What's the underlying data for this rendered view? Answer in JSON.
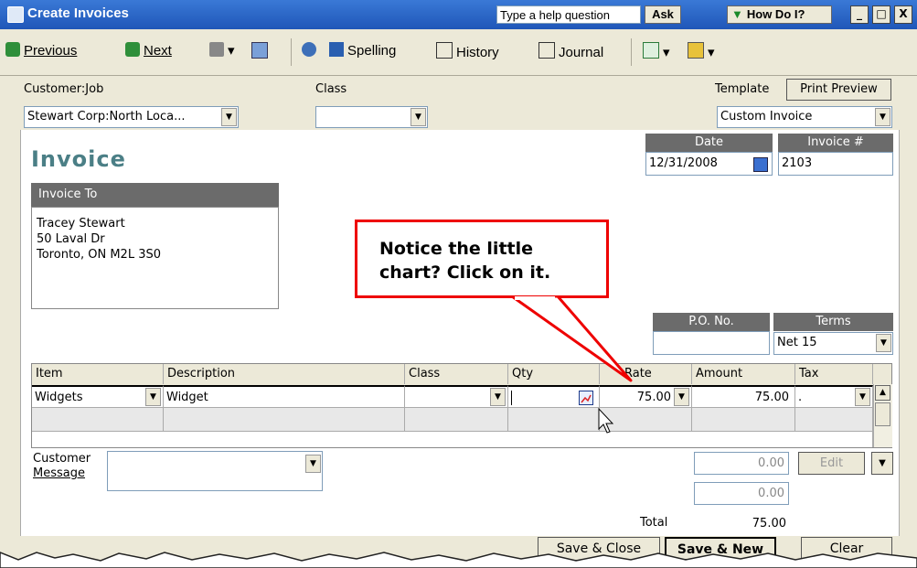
{
  "window": {
    "title": "Create Invoices",
    "help_placeholder": "Type a help question",
    "ask_label": "Ask",
    "howdo_label": "How Do I?"
  },
  "toolbar": {
    "previous": "Previous",
    "next": "Next",
    "spelling": "Spelling",
    "history": "History",
    "journal": "Journal"
  },
  "form": {
    "customer_job_label": "Customer:Job",
    "customer_job_value": "Stewart Corp:North Loca...",
    "class_label": "Class",
    "class_value": "",
    "template_label": "Template",
    "print_preview_label": "Print Preview",
    "template_value": "Custom Invoice",
    "invoice_heading": "Invoice",
    "date_label": "Date",
    "date_value": "12/31/2008",
    "invoice_no_label": "Invoice #",
    "invoice_no_value": "2103",
    "invoice_to_label": "Invoice To",
    "bill_to": [
      "Tracey Stewart",
      "50 Laval Dr",
      "Toronto, ON M2L 3S0"
    ],
    "po_label": "P.O. No.",
    "po_value": "",
    "terms_label": "Terms",
    "terms_value": "Net 15"
  },
  "grid": {
    "columns": [
      "Item",
      "Description",
      "Class",
      "Qty",
      "Rate",
      "Amount",
      "Tax"
    ],
    "rows": [
      {
        "item": "Widgets",
        "description": "Widget",
        "class": "",
        "qty": "",
        "rate": "75.00",
        "amount": "75.00",
        "tax": "."
      }
    ]
  },
  "footer": {
    "customer_message_label_1": "Customer",
    "customer_message_label_2": "Message",
    "subtotal_value": "0.00",
    "edit_label": "Edit",
    "balance_value": "0.00",
    "total_label": "Total",
    "total_value": "75.00",
    "save_close": "Save & Close",
    "save_new": "Save & New",
    "clear": "Clear"
  },
  "callout": {
    "line1": "Notice the little",
    "line2": "chart? Click on it."
  },
  "colors": {
    "titlebar": "#2a66c9",
    "accent_heading": "#4b7f86",
    "callout_border": "#ee0000",
    "header_bg": "#6b6b6b"
  }
}
